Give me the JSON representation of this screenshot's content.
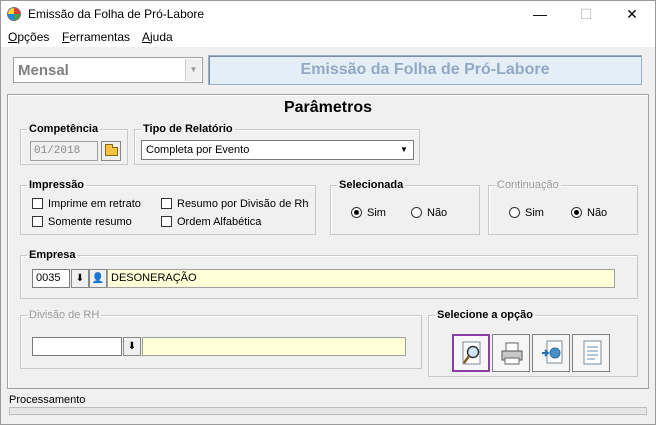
{
  "window": {
    "title": "Emissão da Folha de Pró-Labore",
    "controls": {
      "minimize": "—",
      "maximize": "☐",
      "close": "✕"
    }
  },
  "menu": [
    {
      "label": "Opções",
      "accel": "O",
      "rest": "pções"
    },
    {
      "label": "Ferramentas",
      "accel": "F",
      "rest": "erramentas"
    },
    {
      "label": "Ajuda",
      "accel": "A",
      "rest": "juda"
    }
  ],
  "header": {
    "period_value": "Mensal",
    "banner_title": "Emissão da Folha de Pró-Labore"
  },
  "parametros": {
    "title": "Parâmetros",
    "competencia": {
      "legend": "Competência",
      "value": "01/2018"
    },
    "tipo_relatorio": {
      "legend": "Tipo de Relatório",
      "value": "Completa por Evento"
    },
    "impressao": {
      "legend": "Impressão",
      "options": [
        {
          "label": "Imprime em retrato",
          "checked": false
        },
        {
          "label": "Resumo por Divisão de Rh",
          "checked": false
        },
        {
          "label": "Somente resumo",
          "checked": false
        },
        {
          "label": "Ordem Alfabética",
          "checked": false
        }
      ]
    },
    "selecionada": {
      "legend": "Selecionada",
      "options": [
        {
          "label": "Sim",
          "selected": true
        },
        {
          "label": "Não",
          "selected": false
        }
      ]
    },
    "continuacao": {
      "legend": "Continuação",
      "options": [
        {
          "label": "Sim",
          "selected": false
        },
        {
          "label": "Não",
          "selected": true
        }
      ]
    },
    "empresa": {
      "legend": "Empresa",
      "code": "0035",
      "name": "DESONERAÇÃO"
    },
    "divisao": {
      "legend": "Divisão de RH",
      "code": "",
      "name": ""
    },
    "selecione": {
      "legend": "Selecione a opção",
      "buttons": [
        {
          "name": "preview",
          "icon": "magnifier-preview-icon",
          "selected": true
        },
        {
          "name": "print",
          "icon": "printer-icon",
          "selected": false
        },
        {
          "name": "export",
          "icon": "export-document-icon",
          "selected": false
        },
        {
          "name": "text-file",
          "icon": "text-document-icon",
          "selected": false
        }
      ]
    }
  },
  "status": {
    "label": "Processamento",
    "progress": 0
  }
}
